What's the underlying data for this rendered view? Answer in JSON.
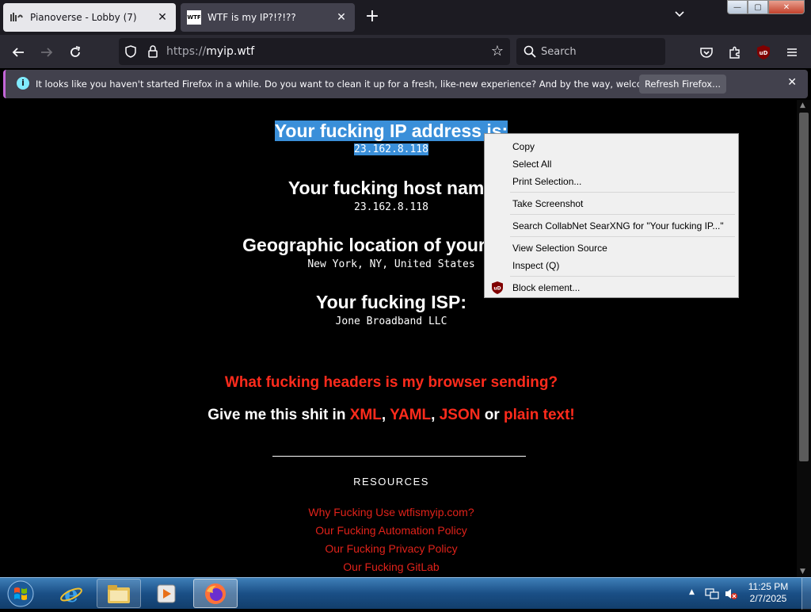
{
  "window": {
    "tabs": [
      {
        "title": "Pianoverse - Lobby (7)",
        "active": false
      },
      {
        "title": "WTF is my IP?!?!??",
        "active": true
      }
    ],
    "favicon_text": "WTF",
    "new_tab": "+",
    "tab_list": "⌄",
    "controls": {
      "minimize": "—",
      "maximize": "▢",
      "close": "✕"
    }
  },
  "nav": {
    "url_protocol": "https://",
    "url_host": "myip.wtf",
    "search_placeholder": "Search",
    "ublock_badge": "uD"
  },
  "notification": {
    "message": "It looks like you haven't started Firefox in a while. Do you want to clean it up for a fresh, like-new experience? And by the way, welcome back!",
    "button": "Refresh Firefox...",
    "close": "✕"
  },
  "page": {
    "ip_heading": "Your fucking IP address is:",
    "ip_value": "23.162.8.118",
    "host_heading": "Your fucking host name",
    "host_value": "23.162.8.118",
    "geo_heading": "Geographic location of your fuckir",
    "geo_value": "New York, NY, United States",
    "isp_heading": "Your fucking ISP:",
    "isp_value": "Jone Broadband LLC",
    "headers_link": "What fucking headers is my browser sending?",
    "give_prefix": "Give me this shit in ",
    "formats": {
      "xml": "XML",
      "yaml": "YAML",
      "json": "JSON",
      "plain": "plain text!"
    },
    "comma": ",",
    "or": "or",
    "resources_title": "RESOURCES",
    "resource_links": [
      "Why Fucking Use wtfismyip.com?",
      "Our Fucking Automation Policy",
      "Our Fucking Privacy Policy",
      "Our Fucking GitLab"
    ]
  },
  "context_menu": {
    "items": [
      "Copy",
      "Select All",
      "Print Selection...",
      "Take Screenshot",
      "Search CollabNet SearXNG for \"Your fucking IP...\"",
      "View Selection Source",
      "Inspect (Q)",
      "Block element..."
    ]
  },
  "taskbar": {
    "time": "11:25 PM",
    "date": "2/7/2025"
  },
  "colors": {
    "selection": "#3a8fd9",
    "link_red": "#ff2b1c",
    "toolbar": "#2b2a33",
    "tabstrip": "#1c1b22"
  }
}
